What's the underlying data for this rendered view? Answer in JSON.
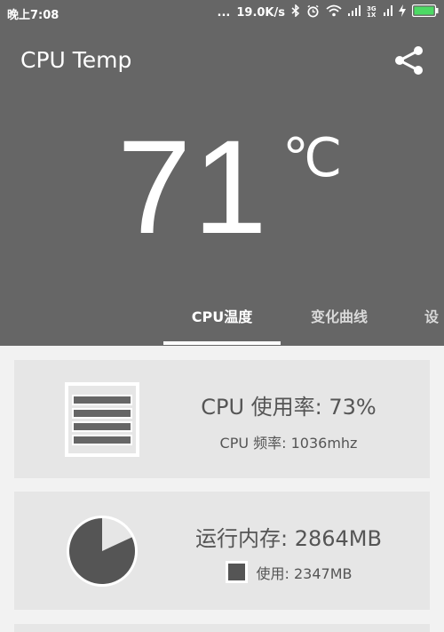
{
  "status_bar": {
    "time": "晚上7:08",
    "dots": "...",
    "speed": "19.0K/s",
    "network_label": "3G\n1X"
  },
  "app": {
    "title": "CPU Temp"
  },
  "temperature": {
    "value": "71",
    "unit": "℃"
  },
  "tabs": [
    {
      "label": "CPU温度"
    },
    {
      "label": "变化曲线"
    },
    {
      "label": "设"
    }
  ],
  "cards": {
    "cpu": {
      "usage_text": "CPU 使用率: 73%",
      "freq_text": "CPU 频率: 1036mhz",
      "usage_percent": 73
    },
    "memory": {
      "total_text": "运行内存: 2864MB",
      "used_text": "使用: 2347MB",
      "used_mb": 2347,
      "total_mb": 2864
    }
  },
  "colors": {
    "header_bg": "#666666",
    "card_bg": "#e6e6e6",
    "text": "#555555"
  }
}
